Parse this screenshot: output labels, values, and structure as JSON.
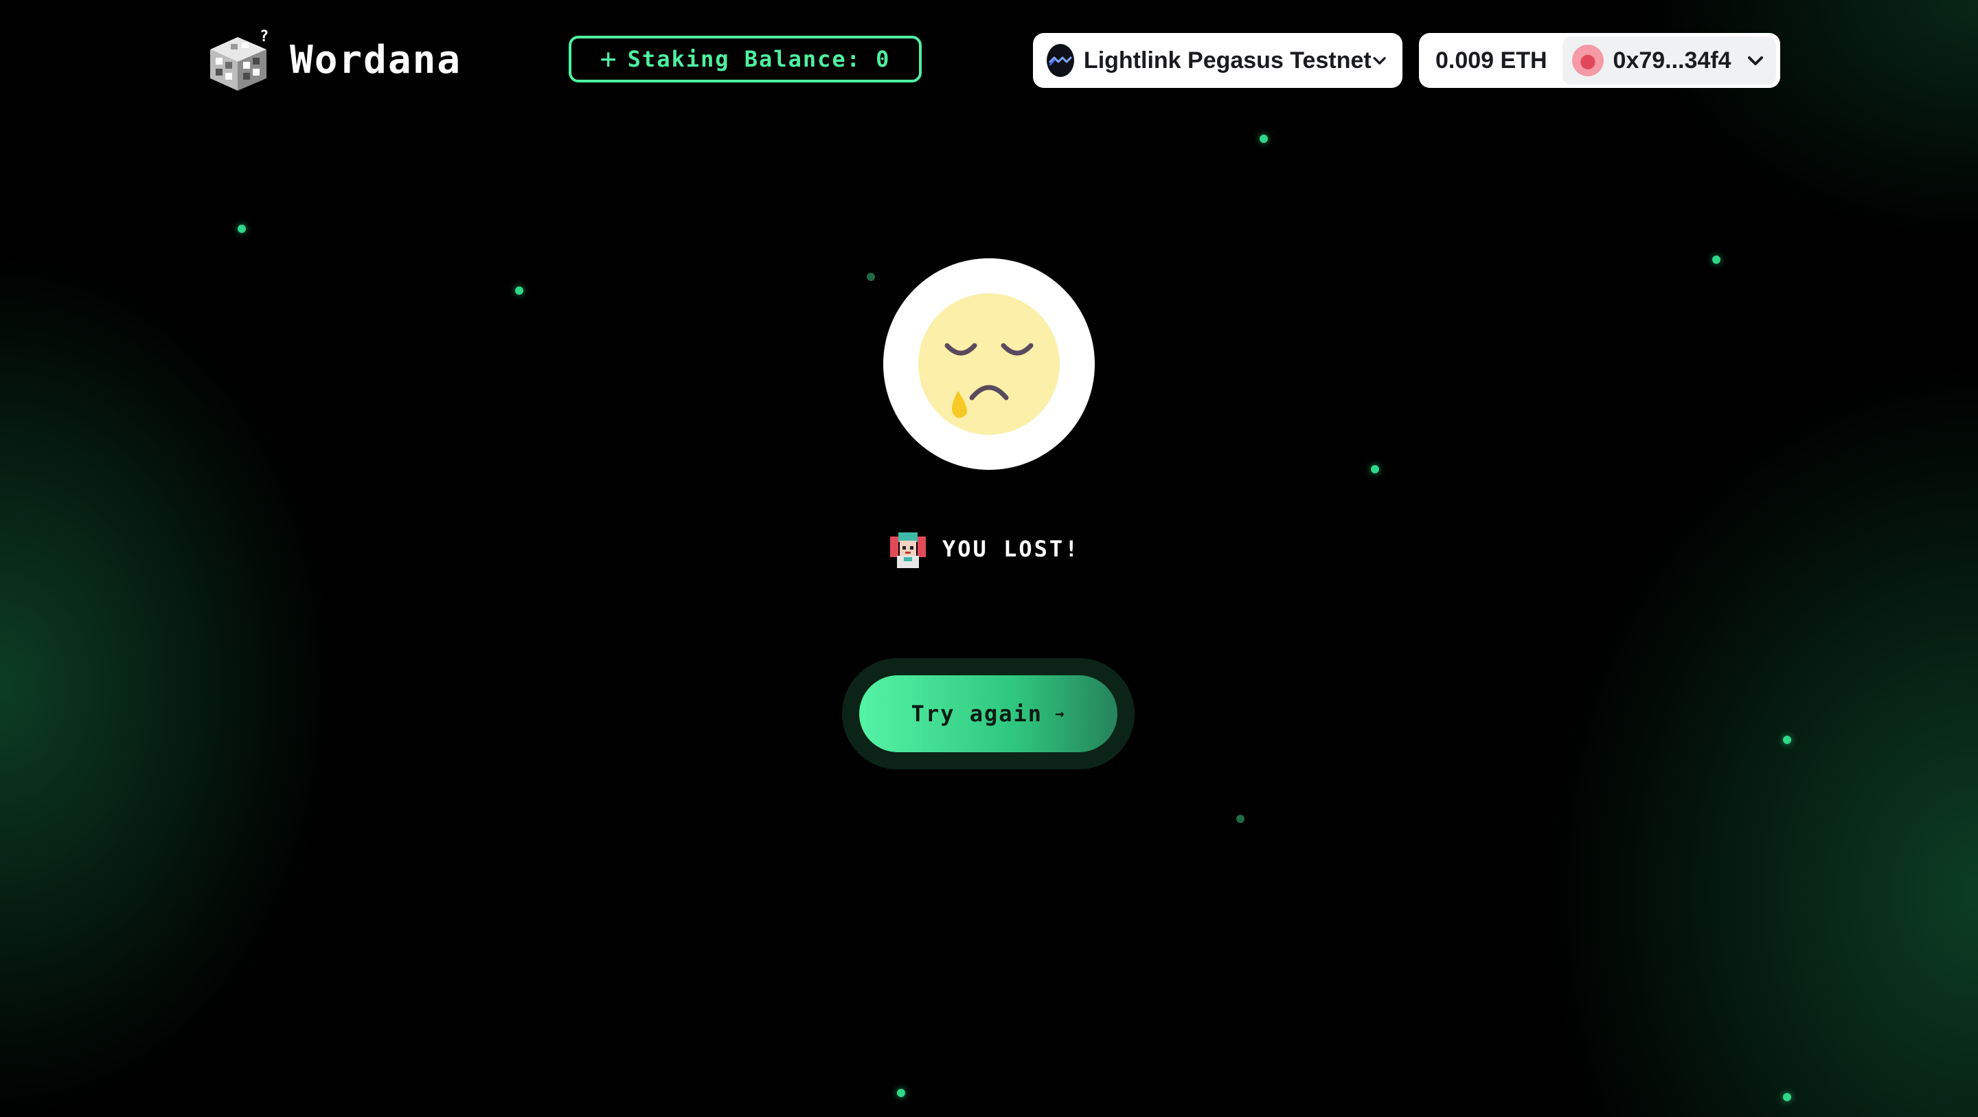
{
  "header": {
    "logo_text": "Wordana",
    "staking": {
      "plus": "+",
      "label": "Staking Balance: 0"
    },
    "network": {
      "label": "Lightlink Pegasus Testnet",
      "icon": "lightlink-wave-icon"
    },
    "account": {
      "balance": "0.009 ETH",
      "address": "0x79...34f4"
    }
  },
  "result": {
    "text": "YOU LOST!"
  },
  "action": {
    "button_label": "Try again",
    "arrow": "→"
  },
  "colors": {
    "accent": "#4ff0a0",
    "background": "#000000",
    "glow": "#167042",
    "face": "#fcefa9"
  }
}
